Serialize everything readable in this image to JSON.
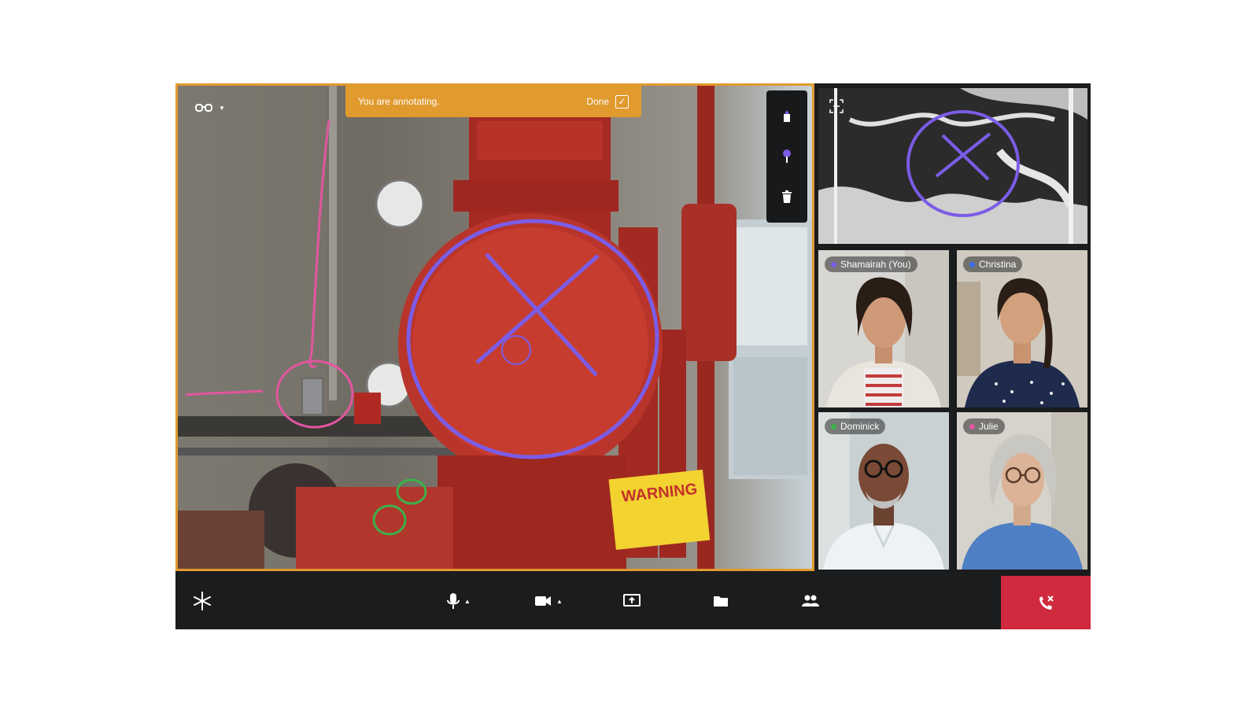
{
  "banner": {
    "message": "You are annotating.",
    "done_label": "Done"
  },
  "participants": [
    {
      "name": "Shamairah (You)",
      "dot_color": "#7b5ce6"
    },
    {
      "name": "Christina",
      "dot_color": "#3a6ef0"
    },
    {
      "name": "Dominick",
      "dot_color": "#3db24a"
    },
    {
      "name": "Julie",
      "dot_color": "#e2559f"
    }
  ],
  "colors": {
    "accent": "#e19a2e",
    "end_call": "#cf2a3e",
    "annotate_purple": "#7b5ce6",
    "annotate_pink": "#e2559f",
    "annotate_green": "#3db24a"
  },
  "icons": [
    "glasses-icon",
    "pen-icon",
    "pin-icon",
    "trash-icon",
    "move-icon",
    "logo-icon",
    "microphone-icon",
    "camera-icon",
    "share-screen-icon",
    "folder-icon",
    "people-icon",
    "end-call-icon"
  ]
}
